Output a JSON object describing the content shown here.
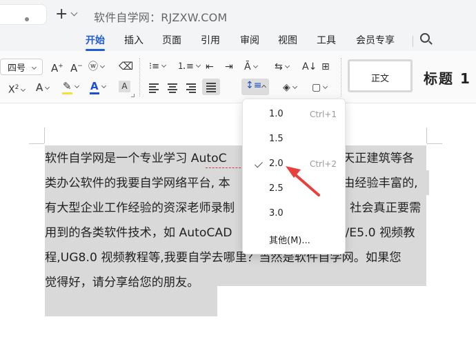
{
  "window": {
    "title": "软件自学网：RJZXW.COM",
    "new_tab_symbol": "+"
  },
  "menu": {
    "tabs": [
      "开始",
      "插入",
      "页面",
      "引用",
      "审阅",
      "视图",
      "工具",
      "会员专享"
    ],
    "active": "开始"
  },
  "ribbon": {
    "font_size_value": "四号",
    "style_normal": "正文",
    "style_heading": "标题 1",
    "accent_color": "#1e5bd6",
    "highlight_color": "#f5e13a",
    "font_color": "#1a4fd0"
  },
  "line_spacing_menu": {
    "items": [
      {
        "label": "1.0",
        "shortcut": "Ctrl+1",
        "checked": false
      },
      {
        "label": "1.5",
        "shortcut": "",
        "checked": false
      },
      {
        "label": "2.0",
        "shortcut": "Ctrl+2",
        "checked": true
      },
      {
        "label": "2.5",
        "shortcut": "",
        "checked": false
      },
      {
        "label": "3.0",
        "shortcut": "",
        "checked": false
      },
      {
        "label": "其他(M)...",
        "shortcut": "",
        "checked": false
      }
    ]
  },
  "document": {
    "lines": [
      "软件自学网是一个专业学习 AutoC",
      "类办公软件的我要自学网络平台, 本",
      "有大型企业工作经验的资深老师录制",
      "用到的各类软件技术，如 AutoCAD",
      "程,UG8.0 视频教程等,我要自学去哪里？当然是软件自学网。如果您",
      "觉得好，请分享给您的朋友。"
    ],
    "line_tails": [
      "天正建筑等各",
      "由经验丰富的,",
      "社会真正要需",
      "o/E5.0 视频教",
      "",
      ""
    ],
    "selection_color": "#d9d9d9"
  },
  "annotation": {
    "arrow_color": "#e8403a"
  }
}
